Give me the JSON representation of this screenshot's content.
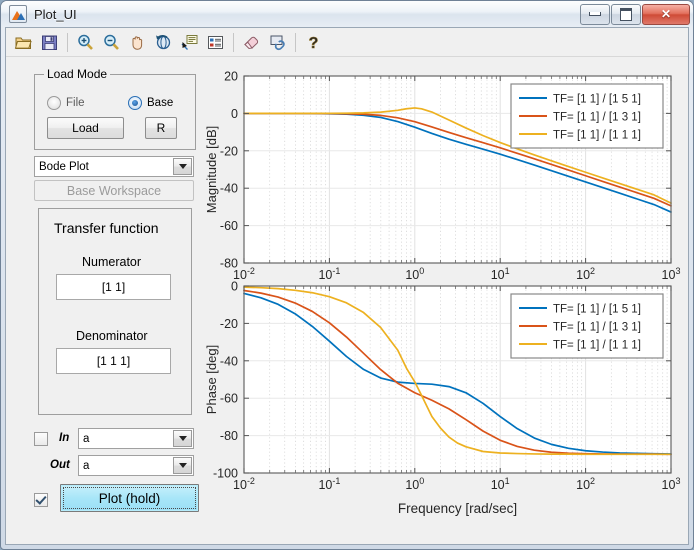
{
  "window": {
    "title": "Plot_UI",
    "buttons": {
      "minimize": "–",
      "maximize": "□",
      "close": "✕"
    }
  },
  "toolbar": {
    "items": [
      {
        "name": "open-file-icon",
        "tooltip": "Open File"
      },
      {
        "name": "save-icon",
        "tooltip": "Save Figure"
      },
      {
        "name": "zoom-in-icon",
        "tooltip": "Zoom In"
      },
      {
        "name": "zoom-out-icon",
        "tooltip": "Zoom Out"
      },
      {
        "name": "pan-icon",
        "tooltip": "Pan"
      },
      {
        "name": "rotate-3d-icon",
        "tooltip": "Rotate 3D"
      },
      {
        "name": "data-cursor-icon",
        "tooltip": "Data Cursor"
      },
      {
        "name": "legend-icon",
        "tooltip": "Insert Legend"
      },
      {
        "name": "brush-icon",
        "tooltip": "Brush/Select Data"
      },
      {
        "name": "link-data-icon",
        "tooltip": "Link Plot"
      },
      {
        "name": "help-icon",
        "tooltip": "Help"
      }
    ]
  },
  "panel": {
    "load_mode": {
      "title": "Load Mode",
      "radio_file": {
        "label": "File",
        "selected": false
      },
      "radio_base": {
        "label": "Base",
        "selected": true
      },
      "load_button": "Load",
      "r_button": "R"
    },
    "plot_type_select": {
      "value": "Bode Plot"
    },
    "workspace_button": {
      "label": "Base Workspace",
      "enabled": false
    },
    "transfer_function": {
      "title": "Transfer function",
      "numerator_label": "Numerator",
      "numerator_value": "[1 1]",
      "denominator_label": "Denominator",
      "denominator_value": "[1 1 1]"
    },
    "in_row": {
      "label": "In",
      "checked": false,
      "value": "a"
    },
    "out_row": {
      "label": "Out",
      "value": "a"
    },
    "plot_row": {
      "checked": true,
      "button_label": "Plot (hold)"
    }
  },
  "chart_data": [
    {
      "type": "line",
      "id": "magnitude",
      "title": "",
      "xlabel": "",
      "ylabel": "Magnitude [dB]",
      "xscale": "log",
      "xlim": [
        0.01,
        1000
      ],
      "ylim": [
        -80,
        20
      ],
      "yticks": [
        20,
        0,
        -20,
        -40,
        -60,
        -80
      ],
      "xticks": [
        0.01,
        0.1,
        1,
        10,
        100,
        1000
      ],
      "xtick_labels": [
        "10^-2",
        "10^-1",
        "10^0",
        "10^1",
        "10^2",
        "10^3"
      ],
      "grid": true,
      "legend_position": "top-right",
      "series": [
        {
          "name": "TF= [1 1] / [1 5 1]",
          "color": "#0072BD",
          "x": [
            0.01,
            0.0158,
            0.0251,
            0.0398,
            0.0631,
            0.1,
            0.1585,
            0.2512,
            0.3981,
            0.631,
            1.0,
            1.585,
            2.512,
            3.981,
            6.31,
            10.0,
            15.85,
            25.12,
            39.81,
            63.1,
            100.0,
            158.5,
            251.2,
            398.1,
            631.0,
            1000.0
          ],
          "y": [
            0.0,
            -0.01,
            -0.01,
            -0.03,
            -0.07,
            -0.18,
            -0.42,
            -0.98,
            -2.17,
            -4.35,
            -7.38,
            -10.74,
            -13.81,
            -16.52,
            -19.13,
            -21.83,
            -24.67,
            -27.62,
            -30.61,
            -33.63,
            -36.65,
            -39.67,
            -42.69,
            -45.71,
            -48.73,
            -52.75
          ]
        },
        {
          "name": "TF= [1 1] / [1 3 1]",
          "color": "#D95319",
          "x": [
            0.01,
            0.0158,
            0.0251,
            0.0398,
            0.0631,
            0.1,
            0.1585,
            0.2512,
            0.3981,
            0.631,
            1.0,
            1.585,
            2.512,
            3.981,
            6.31,
            10.0,
            15.85,
            25.12,
            39.81,
            63.1,
            100.0,
            158.5,
            251.2,
            398.1,
            631.0,
            1000.0
          ],
          "y": [
            0.0,
            0.0,
            -0.01,
            -0.01,
            -0.03,
            -0.08,
            -0.19,
            -0.46,
            -1.07,
            -2.36,
            -4.44,
            -7.24,
            -10.21,
            -12.97,
            -15.66,
            -18.43,
            -21.32,
            -24.29,
            -27.3,
            -30.32,
            -33.34,
            -36.36,
            -39.38,
            -42.4,
            -45.42,
            -49.44
          ]
        },
        {
          "name": "TF= [1 1] / [1 1 1]",
          "color": "#EDB120",
          "x": [
            0.01,
            0.0158,
            0.0251,
            0.0398,
            0.0631,
            0.1,
            0.1585,
            0.2512,
            0.3981,
            0.631,
            0.8,
            1.0,
            1.2,
            1.585,
            2.512,
            3.981,
            6.31,
            10.0,
            15.85,
            25.12,
            39.81,
            63.1,
            100.0,
            158.5,
            251.2,
            398.1,
            631.0,
            1000.0
          ],
          "y": [
            0.0,
            0.0,
            0.0,
            0.0,
            0.01,
            0.04,
            0.1,
            0.26,
            0.67,
            1.65,
            2.48,
            2.93,
            2.45,
            0.73,
            -3.55,
            -7.85,
            -11.88,
            -15.6,
            -18.94,
            -22.2,
            -25.35,
            -28.43,
            -31.47,
            -34.5,
            -37.52,
            -40.54,
            -43.56,
            -48.0
          ]
        }
      ]
    },
    {
      "type": "line",
      "id": "phase",
      "title": "",
      "xlabel": "Frequency [rad/sec]",
      "ylabel": "Phase [deg]",
      "xscale": "log",
      "xlim": [
        0.01,
        1000
      ],
      "ylim": [
        -100,
        0
      ],
      "yticks": [
        0,
        -20,
        -40,
        -60,
        -80,
        -100
      ],
      "xticks": [
        0.01,
        0.1,
        1,
        10,
        100,
        1000
      ],
      "xtick_labels": [
        "10^-2",
        "10^-1",
        "10^0",
        "10^1",
        "10^2",
        "10^3"
      ],
      "grid": true,
      "legend_position": "top-right",
      "series": [
        {
          "name": "TF= [1 1] / [1 5 1]",
          "color": "#0072BD",
          "x": [
            0.01,
            0.0158,
            0.0251,
            0.0398,
            0.0631,
            0.1,
            0.1585,
            0.2512,
            0.3981,
            0.631,
            1.0,
            1.585,
            2.512,
            3.981,
            6.31,
            10.0,
            15.85,
            25.12,
            39.81,
            63.1,
            100.0,
            158.5,
            251.2,
            398.1,
            631.0,
            1000.0
          ],
          "y": [
            -4.0,
            -6.3,
            -9.8,
            -14.9,
            -21.6,
            -29.5,
            -37.7,
            -44.6,
            -49.2,
            -51.4,
            -52.1,
            -52.5,
            -53.8,
            -57.1,
            -62.8,
            -69.8,
            -76.3,
            -81.3,
            -84.7,
            -86.8,
            -88.1,
            -88.8,
            -89.3,
            -89.5,
            -89.7,
            -89.8
          ]
        },
        {
          "name": "TF= [1 1] / [1 3 1]",
          "color": "#D95319",
          "x": [
            0.01,
            0.0158,
            0.0251,
            0.0398,
            0.0631,
            0.1,
            0.1585,
            0.2512,
            0.3981,
            0.631,
            1.0,
            1.585,
            2.512,
            3.981,
            6.31,
            10.0,
            15.85,
            25.12,
            39.81,
            63.1,
            100.0,
            158.5,
            251.2,
            398.1,
            631.0,
            1000.0
          ],
          "y": [
            -2.4,
            -3.8,
            -5.9,
            -9.1,
            -13.6,
            -19.7,
            -27.3,
            -36.0,
            -44.7,
            -52.0,
            -57.1,
            -61.1,
            -65.7,
            -71.5,
            -77.6,
            -82.5,
            -85.8,
            -87.8,
            -88.9,
            -89.4,
            -89.7,
            -89.8,
            -89.9,
            -89.9,
            -89.9,
            -90.0
          ]
        },
        {
          "name": "TF= [1 1] / [1 1 1]",
          "color": "#EDB120",
          "x": [
            0.01,
            0.0158,
            0.0251,
            0.0398,
            0.0631,
            0.1,
            0.1585,
            0.2512,
            0.3981,
            0.631,
            0.8,
            1.0,
            1.2,
            1.585,
            2.0,
            2.512,
            3.162,
            3.981,
            6.31,
            10.0,
            15.85,
            25.12,
            39.81,
            63.1,
            100.0,
            158.5,
            251.2,
            398.1,
            631.0,
            1000.0
          ],
          "y": [
            -0.6,
            -0.9,
            -1.4,
            -2.3,
            -3.6,
            -5.7,
            -9.0,
            -14.2,
            -22.2,
            -34.3,
            -44.0,
            -51.3,
            -58.5,
            -69.8,
            -76.0,
            -80.8,
            -84.0,
            -86.0,
            -88.5,
            -89.3,
            -89.6,
            -89.8,
            -89.9,
            -89.9,
            -90.0,
            -90.0,
            -90.0,
            -90.0,
            -90.0,
            -90.0
          ]
        }
      ]
    }
  ]
}
